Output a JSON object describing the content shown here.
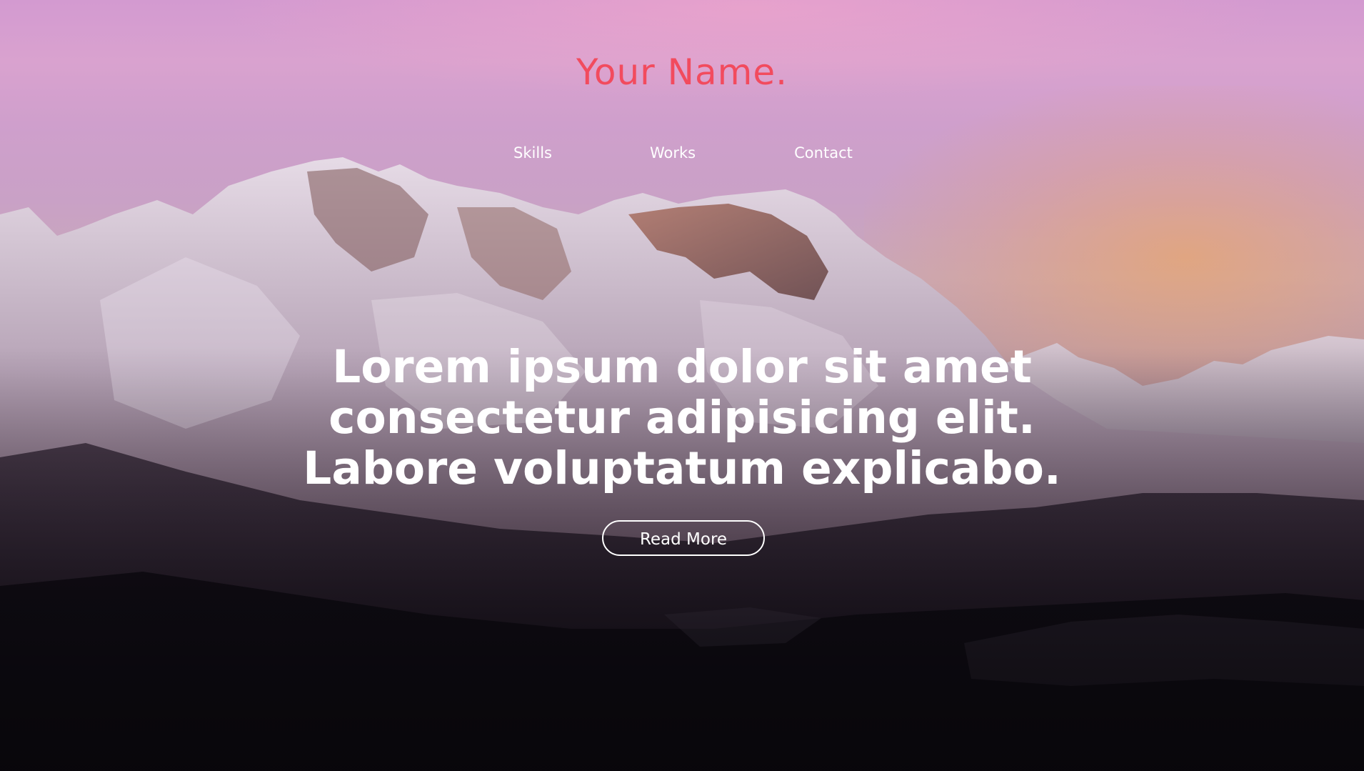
{
  "brand": {
    "name": "Your Name."
  },
  "nav": {
    "items": [
      {
        "label": "Skills"
      },
      {
        "label": "Works"
      },
      {
        "label": "Contact"
      }
    ]
  },
  "hero": {
    "headline_lines": [
      "Lorem ipsum dolor sit amet",
      "consectetur adipisicing elit.",
      "Labore voluptatum explicabo."
    ],
    "cta_label": "Read More"
  },
  "colors": {
    "brand": "#f24b5e",
    "text": "#ffffff"
  },
  "background": {
    "description_icon": "mountain-landscape"
  }
}
